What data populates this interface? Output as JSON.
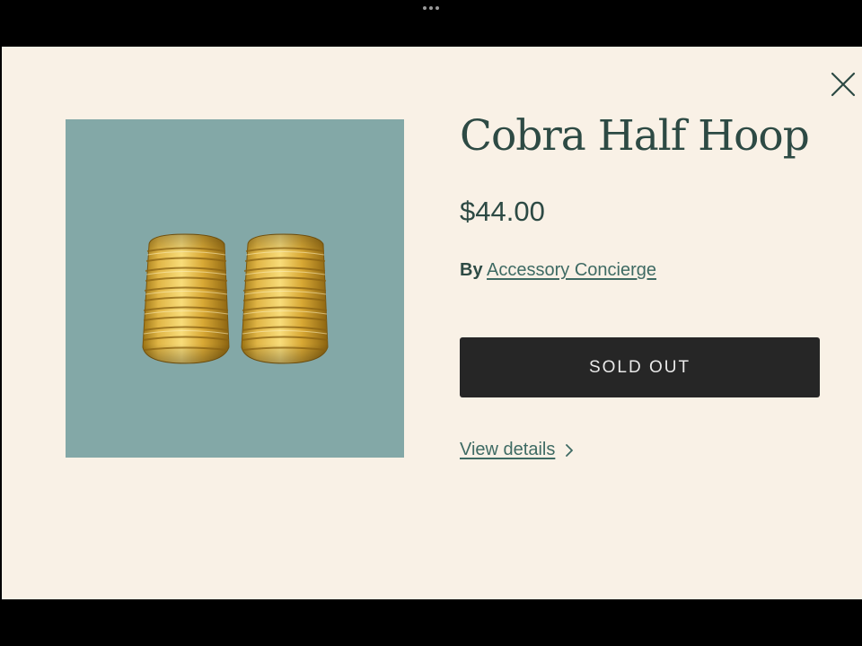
{
  "window": {
    "handle_icon": "more-dots-icon"
  },
  "modal": {
    "close_icon": "close-icon",
    "product": {
      "image_alt": "gold ribbed half hoop earrings",
      "title": "Cobra Half Hoop",
      "price": "$44.00",
      "vendor_prefix": "By",
      "vendor_name": "Accessory Concierge",
      "button_label": "SOLD OUT",
      "view_details_label": "View details",
      "view_details_icon": "chevron-right-icon"
    }
  },
  "colors": {
    "background": "#f9f1e6",
    "accent_text": "#2d4a44",
    "image_background": "#83a8a7",
    "button_background": "#262626",
    "button_text": "#e9e9e9"
  }
}
